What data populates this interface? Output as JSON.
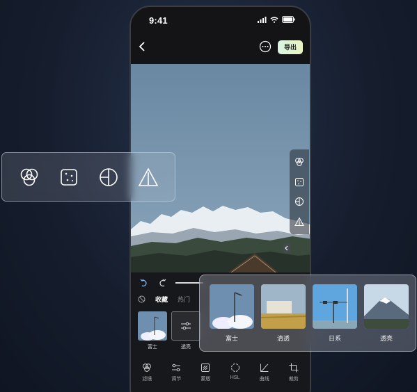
{
  "status_bar": {
    "time": "9:41"
  },
  "nav": {
    "export_label": "导出"
  },
  "filter_tabs": {
    "favorites": "收藏",
    "hot": "热门"
  },
  "thumbnails": [
    {
      "label": "富士"
    },
    {
      "label": "透亮"
    }
  ],
  "bottom_nav": [
    {
      "label": "滤镜",
      "icon": "filter-icon"
    },
    {
      "label": "调节",
      "icon": "adjust-icon"
    },
    {
      "label": "蒙版",
      "icon": "mask-icon"
    },
    {
      "label": "HSL",
      "icon": "hsl-icon"
    },
    {
      "label": "曲线",
      "icon": "curve-icon"
    },
    {
      "label": "裁剪",
      "icon": "crop-icon"
    }
  ],
  "floating_filters": [
    {
      "label": "富士"
    },
    {
      "label": "清透"
    },
    {
      "label": "日系"
    },
    {
      "label": "透亮"
    }
  ],
  "colors": {
    "export_button": "#dff5d0",
    "background": "#161e2e"
  }
}
